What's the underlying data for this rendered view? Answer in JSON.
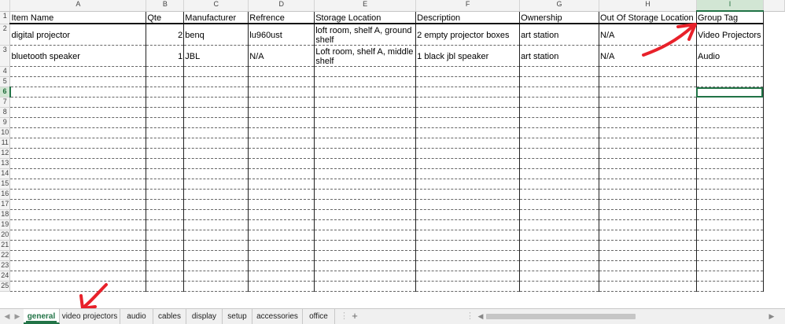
{
  "columns": [
    "A",
    "B",
    "C",
    "D",
    "E",
    "F",
    "G",
    "H",
    "I"
  ],
  "selected_column": "I",
  "row_numbers": [
    "1",
    "2",
    "3",
    "4",
    "5",
    "6",
    "7",
    "8",
    "9",
    "10",
    "11",
    "12",
    "13",
    "14",
    "15",
    "16",
    "17",
    "18",
    "19",
    "20",
    "21",
    "22",
    "23",
    "24",
    "25"
  ],
  "selected_row": "6",
  "headers": {
    "item_name": "Item Name",
    "qte": "Qte",
    "manufacturer": "Manufacturer",
    "reference": "Refrence",
    "storage_location": "Storage Location",
    "description": "Description",
    "ownership": "Ownership",
    "out_of_storage": "Out Of Storage Location",
    "group_tag": "Group Tag"
  },
  "rows": [
    {
      "item_name": "digital projector",
      "qte": "2",
      "manufacturer": "benq",
      "reference": "lu960ust",
      "storage_location": "loft room, shelf A, ground shelf",
      "description": "2  empty projector boxes",
      "ownership": "art station",
      "out_of_storage": "N/A",
      "group_tag": "Video Projectors"
    },
    {
      "item_name": "bluetooth speaker",
      "qte": "1",
      "manufacturer": "JBL",
      "reference": "N/A",
      "storage_location": "Loft room, shelf A, middle shelf",
      "description": "1 black jbl speaker",
      "ownership": "art station",
      "out_of_storage": "N/A",
      "group_tag": "Audio"
    }
  ],
  "tabs": [
    "general",
    "video projectors",
    "audio",
    "cables",
    "display",
    "setup",
    "accessories",
    "office"
  ],
  "active_tab": "general",
  "new_sheet_label": "+",
  "annotation_color": "#e8212a",
  "accent_color": "#217346",
  "icons": {
    "nav_prev": "triangle-left-icon",
    "nav_next": "triangle-right-icon",
    "more": "ellipsis-icon",
    "add_sheet": "plus-icon"
  }
}
